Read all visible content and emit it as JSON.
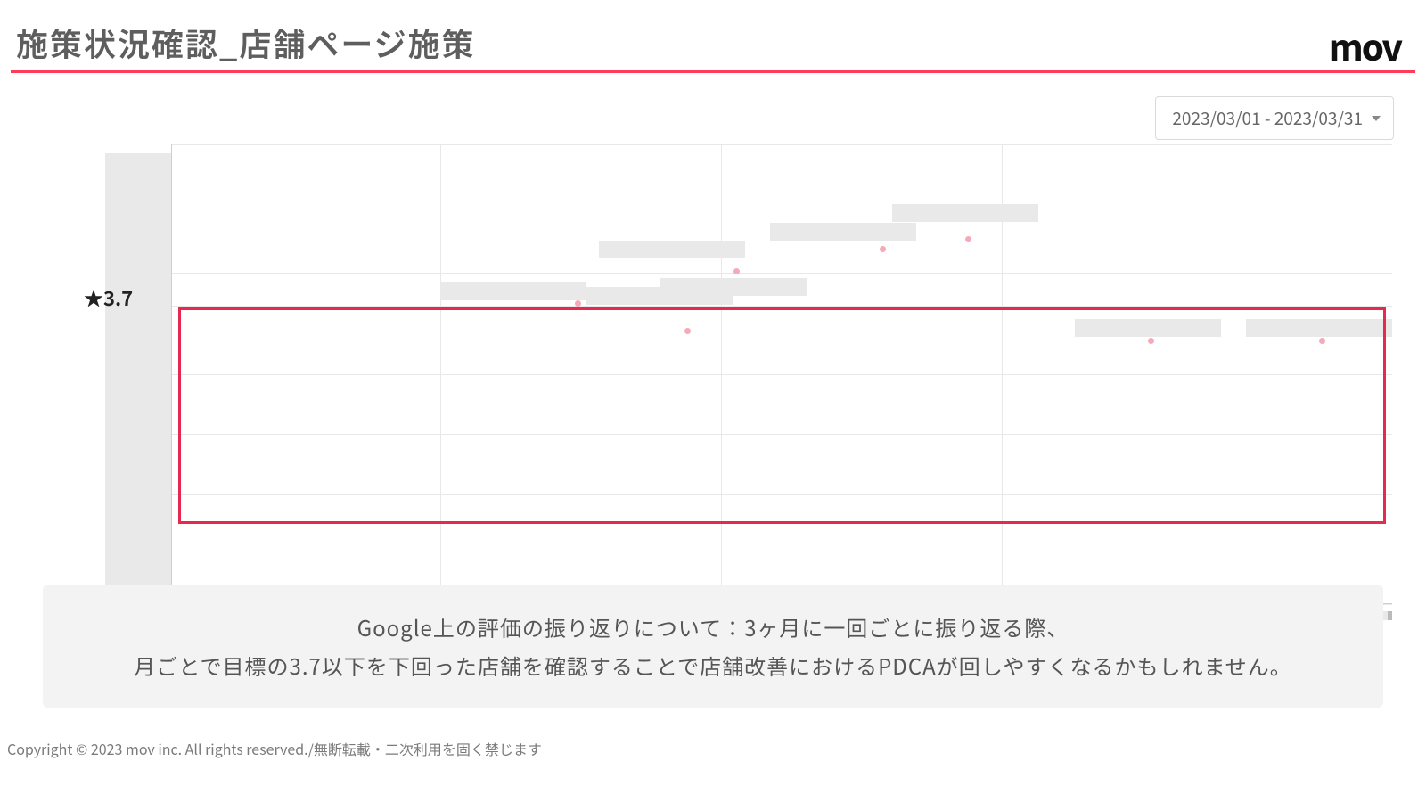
{
  "header": {
    "title": "施策状況確認_店舗ページ施策",
    "logo": "mov"
  },
  "date_picker": {
    "value": "2023/03/01 - 2023/03/31"
  },
  "threshold": {
    "label": "★3.7",
    "value": 3.7
  },
  "caption": {
    "line1": "Google上の評価の振り返りについて：3ヶ月に一回ごとに振り返る際、",
    "line2": "月ごとで目標の3.7以下を下回った店舗を確認することで店舗改善におけるPDCAが回しやすくなるかもしれません。"
  },
  "footer": "Copyright © 2023 mov inc. All rights reserved./無断転載・二次利用を固く禁じます",
  "chart_data": {
    "type": "bar",
    "title": "",
    "xlabel": "",
    "ylabel": "",
    "ylim": [
      3.0,
      4.2
    ],
    "threshold": 3.7,
    "note": "x positions are approximate pixel bins for 9 store columns; values estimated from bar vertical positions relative to the 3.7 threshold line and gridlines",
    "series": [
      {
        "name": "rating_bar",
        "values": [
          null,
          3.75,
          3.73,
          3.9,
          3.8,
          4.0,
          4.05,
          3.63,
          3.63
        ],
        "render": "bar"
      },
      {
        "name": "rating_dot",
        "values": [
          null,
          3.72,
          3.65,
          3.82,
          null,
          3.98,
          4.0,
          3.6,
          3.6
        ],
        "render": "dot"
      }
    ],
    "categories": [
      "",
      "",
      "",
      "",
      "",
      "",
      "",
      "",
      ""
    ]
  }
}
